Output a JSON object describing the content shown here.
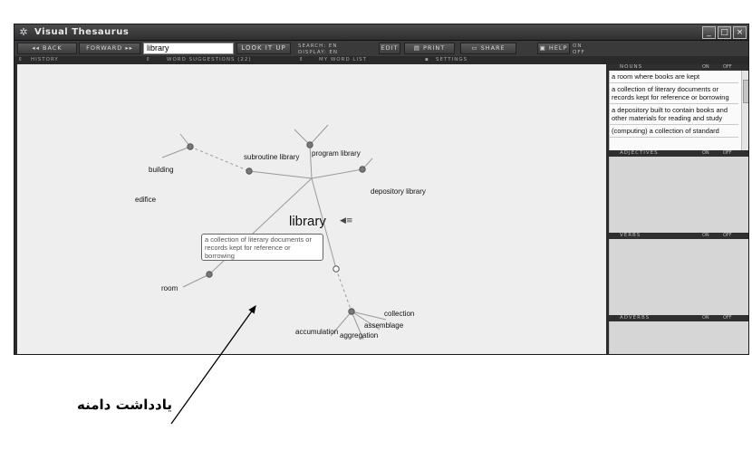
{
  "window": {
    "title": "Visual Thesaurus",
    "logo_icon": "✲",
    "controls": {
      "minimize": "_",
      "maximize": "□",
      "close": "×"
    }
  },
  "toolbar": {
    "back_label": "◂◂ BACK",
    "forward_label": "FORWARD ▸▸",
    "search_value": "library",
    "lookup_label": "LOOK IT UP",
    "search_lang_label": "SEARCH:  EN",
    "display_lang_label": "DISPLAY:  EN",
    "edit_label": "EDIT",
    "print_label": "PRINT",
    "share_label": "SHARE",
    "help_label": "HELP",
    "help_on": "ON",
    "help_off": "OFF"
  },
  "panels": {
    "history": "HISTORY",
    "word_suggestions": "WORD SUGGESTIONS (22)",
    "my_word_list": "MY WORD LIST",
    "settings": "SETTINGS"
  },
  "map": {
    "center_word": "library",
    "speaker_icon": "◀≡",
    "tooltip": "a collection of literary documents or records kept for reference or borrowing",
    "words": {
      "building": "building",
      "edifice": "edifice",
      "subroutine_library": "subroutine library",
      "program_library": "program library",
      "depository_library": "depository library",
      "room": "room",
      "collection": "collection",
      "assemblage": "assemblage",
      "accumulation": "accumulation",
      "aggregation": "aggregation"
    }
  },
  "sidebar": {
    "nouns": {
      "title": "NOUNS",
      "on": "ON",
      "off": "OFF",
      "items": [
        "a room where books are kept",
        "a collection of literary documents or records kept for reference or borrowing",
        "a depository built to contain books and other materials for reading and study",
        "(computing) a collection of standard"
      ]
    },
    "adjectives": {
      "title": "ADJECTIVES",
      "on": "ON",
      "off": "OFF"
    },
    "verbs": {
      "title": "VERBS",
      "on": "ON",
      "off": "OFF"
    },
    "adverbs": {
      "title": "ADVERBS",
      "on": "ON",
      "off": "OFF"
    }
  },
  "annotation": {
    "text": "یادداشت دامنه"
  }
}
